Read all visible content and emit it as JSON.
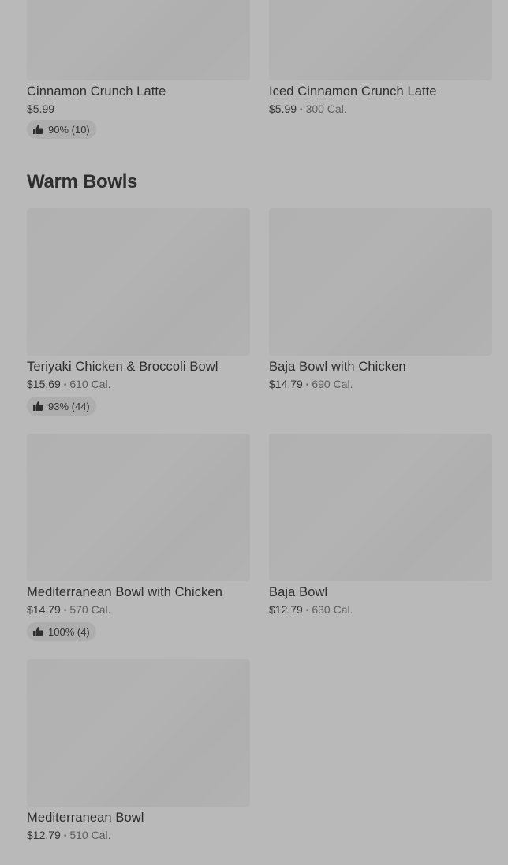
{
  "top_items": [
    {
      "name": "Cinnamon Crunch Latte",
      "price": "$5.99",
      "calories": "",
      "rating": "90% (10)"
    },
    {
      "name": "Iced Cinnamon Crunch Latte",
      "price": "$5.99",
      "calories": "300 Cal.",
      "rating": ""
    }
  ],
  "section": {
    "title": "Warm Bowls",
    "items": [
      {
        "name": "Teriyaki Chicken & Broccoli Bowl",
        "price": "$15.69",
        "calories": "610 Cal.",
        "rating": "93% (44)"
      },
      {
        "name": "Baja Bowl with Chicken",
        "price": "$14.79",
        "calories": "690 Cal.",
        "rating": ""
      },
      {
        "name": "Mediterranean Bowl with Chicken",
        "price": "$14.79",
        "calories": "570 Cal.",
        "rating": "100% (4)"
      },
      {
        "name": "Baja Bowl",
        "price": "$12.79",
        "calories": "630 Cal.",
        "rating": ""
      },
      {
        "name": "Mediterranean Bowl",
        "price": "$12.79",
        "calories": "510 Cal.",
        "rating": ""
      }
    ]
  },
  "separator": "•",
  "icons": {
    "rating": "thumbs-up-icon"
  }
}
